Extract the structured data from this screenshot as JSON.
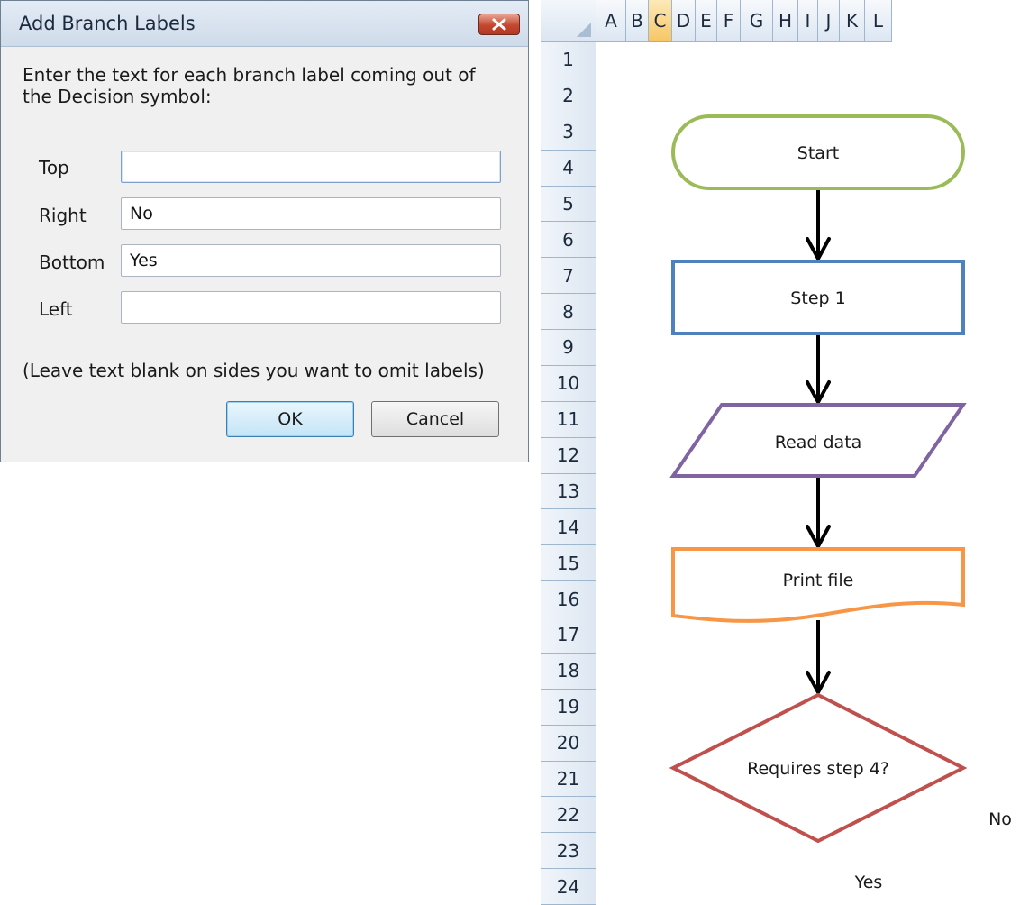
{
  "dialog": {
    "title": "Add Branch Labels",
    "instruction": "Enter the text for each branch label coming out of the Decision symbol:",
    "fields": [
      {
        "label": "Top",
        "value": ""
      },
      {
        "label": "Right",
        "value": "No"
      },
      {
        "label": "Bottom",
        "value": "Yes"
      },
      {
        "label": "Left",
        "value": ""
      }
    ],
    "note": "(Leave text blank on sides you want to omit labels)",
    "ok_label": "OK",
    "cancel_label": "Cancel",
    "close_icon": "close-x-icon"
  },
  "sheet": {
    "selected_column": "C",
    "columns": [
      "A",
      "B",
      "C",
      "D",
      "E",
      "F",
      "G",
      "H",
      "I",
      "J",
      "K",
      "L"
    ],
    "rows": [
      "1",
      "2",
      "3",
      "4",
      "5",
      "6",
      "7",
      "8",
      "9",
      "10",
      "11",
      "12",
      "13",
      "14",
      "15",
      "16",
      "17",
      "18",
      "19",
      "20",
      "21",
      "22",
      "23",
      "24"
    ]
  },
  "flowchart": {
    "start": "Start",
    "process": "Step 1",
    "data": "Read data",
    "document": "Print file",
    "decision": "Requires step 4?",
    "branch_right": "No",
    "branch_bottom": "Yes",
    "colors": {
      "start": "#9bbb59",
      "process": "#4f81bd",
      "data": "#8064a2",
      "document": "#f79646",
      "decision": "#c0504d",
      "arrow": "#000000"
    }
  }
}
